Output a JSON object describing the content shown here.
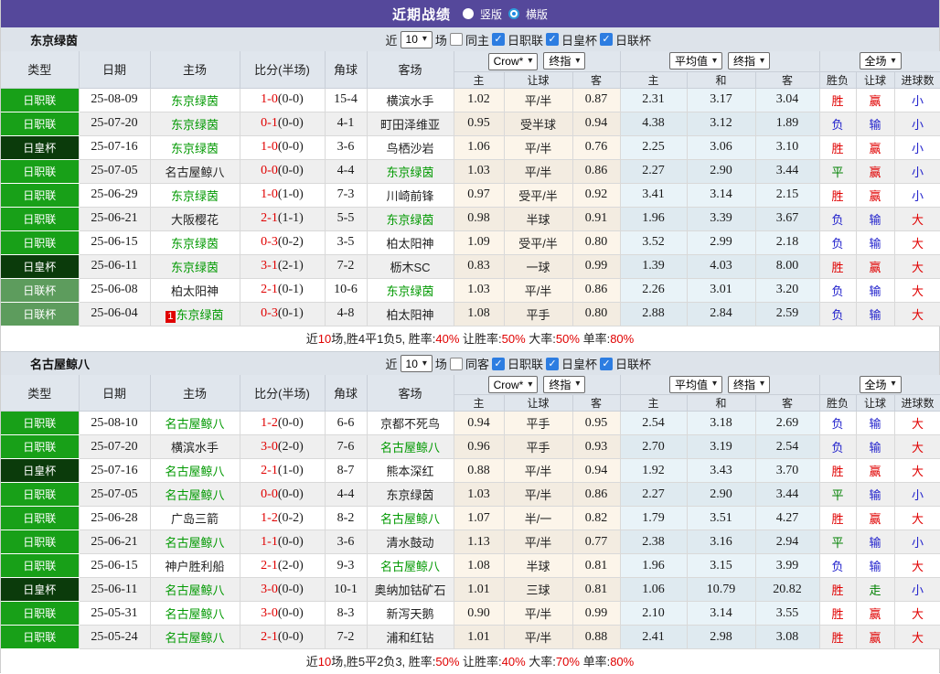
{
  "titlebar": {
    "title": "近期战绩",
    "radio_vertical": "竖版",
    "radio_horizontal": "横版"
  },
  "ui": {
    "near_label": "近",
    "games_value": "10",
    "games_label": "场",
    "league_filters": [
      "日职联",
      "日皇杯",
      "日联杯"
    ]
  },
  "table": {
    "main_headers": [
      "类型",
      "日期",
      "主场",
      "比分(半场)",
      "角球",
      "客场"
    ],
    "odds_subheaders": [
      "主",
      "让球",
      "客"
    ],
    "avg_subheaders": [
      "主",
      "和",
      "客"
    ],
    "result_subheaders": [
      "胜负",
      "让球",
      "进球数"
    ],
    "selects": {
      "bookmaker": "Crow*",
      "final_odds": "终指",
      "average": "平均值",
      "fulltime": "全场"
    }
  },
  "colors": {
    "header_bar": "#55489B",
    "league": {
      "日职联": "#18A018",
      "日皇杯": "#0B3B0B",
      "日联杯": "#5D9C5D"
    },
    "result_map": {
      "胜": "r-red",
      "平": "r-green",
      "负": "r-blue",
      "赢": "r-red",
      "走": "r-green",
      "输": "r-blue",
      "大": "r-red",
      "小": "r-blue"
    }
  },
  "sections": [
    {
      "team": "东京绿茵",
      "same_venue_label": "同主",
      "rows": [
        {
          "league": "日职联",
          "date": "25-08-09",
          "home": "东京绿茵",
          "home_focus": true,
          "home_badge": "",
          "score": "1-0",
          "half": "(0-0)",
          "corner": "15-4",
          "away": "横滨水手",
          "away_focus": false,
          "odds": [
            "1.02",
            "平/半",
            "0.87"
          ],
          "avg": [
            "2.31",
            "3.17",
            "3.04"
          ],
          "res": [
            "胜",
            "赢",
            "小"
          ]
        },
        {
          "league": "日职联",
          "date": "25-07-20",
          "home": "东京绿茵",
          "home_focus": true,
          "home_badge": "",
          "score": "0-1",
          "half": "(0-0)",
          "corner": "4-1",
          "away": "町田泽维亚",
          "away_focus": false,
          "odds": [
            "0.95",
            "受半球",
            "0.94"
          ],
          "avg": [
            "4.38",
            "3.12",
            "1.89"
          ],
          "res": [
            "负",
            "输",
            "小"
          ]
        },
        {
          "league": "日皇杯",
          "date": "25-07-16",
          "home": "东京绿茵",
          "home_focus": true,
          "home_badge": "",
          "score": "1-0",
          "half": "(0-0)",
          "corner": "3-6",
          "away": "鸟栖沙岩",
          "away_focus": false,
          "odds": [
            "1.06",
            "平/半",
            "0.76"
          ],
          "avg": [
            "2.25",
            "3.06",
            "3.10"
          ],
          "res": [
            "胜",
            "赢",
            "小"
          ]
        },
        {
          "league": "日职联",
          "date": "25-07-05",
          "home": "名古屋鲸八",
          "home_focus": false,
          "home_badge": "",
          "score": "0-0",
          "half": "(0-0)",
          "corner": "4-4",
          "away": "东京绿茵",
          "away_focus": true,
          "odds": [
            "1.03",
            "平/半",
            "0.86"
          ],
          "avg": [
            "2.27",
            "2.90",
            "3.44"
          ],
          "res": [
            "平",
            "赢",
            "小"
          ]
        },
        {
          "league": "日职联",
          "date": "25-06-29",
          "home": "东京绿茵",
          "home_focus": true,
          "home_badge": "",
          "score": "1-0",
          "half": "(1-0)",
          "corner": "7-3",
          "away": "川崎前锋",
          "away_focus": false,
          "odds": [
            "0.97",
            "受平/半",
            "0.92"
          ],
          "avg": [
            "3.41",
            "3.14",
            "2.15"
          ],
          "res": [
            "胜",
            "赢",
            "小"
          ]
        },
        {
          "league": "日职联",
          "date": "25-06-21",
          "home": "大阪樱花",
          "home_focus": false,
          "home_badge": "",
          "score": "2-1",
          "half": "(1-1)",
          "corner": "5-5",
          "away": "东京绿茵",
          "away_focus": true,
          "odds": [
            "0.98",
            "半球",
            "0.91"
          ],
          "avg": [
            "1.96",
            "3.39",
            "3.67"
          ],
          "res": [
            "负",
            "输",
            "大"
          ]
        },
        {
          "league": "日职联",
          "date": "25-06-15",
          "home": "东京绿茵",
          "home_focus": true,
          "home_badge": "",
          "score": "0-3",
          "half": "(0-2)",
          "corner": "3-5",
          "away": "柏太阳神",
          "away_focus": false,
          "odds": [
            "1.09",
            "受平/半",
            "0.80"
          ],
          "avg": [
            "3.52",
            "2.99",
            "2.18"
          ],
          "res": [
            "负",
            "输",
            "大"
          ]
        },
        {
          "league": "日皇杯",
          "date": "25-06-11",
          "home": "东京绿茵",
          "home_focus": true,
          "home_badge": "",
          "score": "3-1",
          "half": "(2-1)",
          "corner": "7-2",
          "away": "枥木SC",
          "away_focus": false,
          "odds": [
            "0.83",
            "一球",
            "0.99"
          ],
          "avg": [
            "1.39",
            "4.03",
            "8.00"
          ],
          "res": [
            "胜",
            "赢",
            "大"
          ]
        },
        {
          "league": "日联杯",
          "date": "25-06-08",
          "home": "柏太阳神",
          "home_focus": false,
          "home_badge": "",
          "score": "2-1",
          "half": "(0-1)",
          "corner": "10-6",
          "away": "东京绿茵",
          "away_focus": true,
          "odds": [
            "1.03",
            "平/半",
            "0.86"
          ],
          "avg": [
            "2.26",
            "3.01",
            "3.20"
          ],
          "res": [
            "负",
            "输",
            "大"
          ]
        },
        {
          "league": "日联杯",
          "date": "25-06-04",
          "home": "东京绿茵",
          "home_focus": true,
          "home_badge": "1",
          "score": "0-3",
          "half": "(0-1)",
          "corner": "4-8",
          "away": "柏太阳神",
          "away_focus": false,
          "odds": [
            "1.08",
            "平手",
            "0.80"
          ],
          "avg": [
            "2.88",
            "2.84",
            "2.59"
          ],
          "res": [
            "负",
            "输",
            "大"
          ]
        }
      ],
      "summary": [
        {
          "text": "近"
        },
        {
          "text": "10",
          "red": true
        },
        {
          "text": "场,胜4平1负5, 胜率:"
        },
        {
          "text": "40%",
          "red": true
        },
        {
          "text": " 让胜率:"
        },
        {
          "text": "50%",
          "red": true
        },
        {
          "text": " 大率:"
        },
        {
          "text": "50%",
          "red": true
        },
        {
          "text": " 单率:"
        },
        {
          "text": "80%",
          "red": true
        }
      ]
    },
    {
      "team": "名古屋鲸八",
      "same_venue_label": "同客",
      "rows": [
        {
          "league": "日职联",
          "date": "25-08-10",
          "home": "名古屋鲸八",
          "home_focus": true,
          "home_badge": "",
          "score": "1-2",
          "half": "(0-0)",
          "corner": "6-6",
          "away": "京都不死鸟",
          "away_focus": false,
          "odds": [
            "0.94",
            "平手",
            "0.95"
          ],
          "avg": [
            "2.54",
            "3.18",
            "2.69"
          ],
          "res": [
            "负",
            "输",
            "大"
          ]
        },
        {
          "league": "日职联",
          "date": "25-07-20",
          "home": "横滨水手",
          "home_focus": false,
          "home_badge": "",
          "score": "3-0",
          "half": "(2-0)",
          "corner": "7-6",
          "away": "名古屋鲸八",
          "away_focus": true,
          "odds": [
            "0.96",
            "平手",
            "0.93"
          ],
          "avg": [
            "2.70",
            "3.19",
            "2.54"
          ],
          "res": [
            "负",
            "输",
            "大"
          ]
        },
        {
          "league": "日皇杯",
          "date": "25-07-16",
          "home": "名古屋鲸八",
          "home_focus": true,
          "home_badge": "",
          "score": "2-1",
          "half": "(1-0)",
          "corner": "8-7",
          "away": "熊本深红",
          "away_focus": false,
          "odds": [
            "0.88",
            "平/半",
            "0.94"
          ],
          "avg": [
            "1.92",
            "3.43",
            "3.70"
          ],
          "res": [
            "胜",
            "赢",
            "大"
          ]
        },
        {
          "league": "日职联",
          "date": "25-07-05",
          "home": "名古屋鲸八",
          "home_focus": true,
          "home_badge": "",
          "score": "0-0",
          "half": "(0-0)",
          "corner": "4-4",
          "away": "东京绿茵",
          "away_focus": false,
          "odds": [
            "1.03",
            "平/半",
            "0.86"
          ],
          "avg": [
            "2.27",
            "2.90",
            "3.44"
          ],
          "res": [
            "平",
            "输",
            "小"
          ]
        },
        {
          "league": "日职联",
          "date": "25-06-28",
          "home": "广岛三箭",
          "home_focus": false,
          "home_badge": "",
          "score": "1-2",
          "half": "(0-2)",
          "corner": "8-2",
          "away": "名古屋鲸八",
          "away_focus": true,
          "odds": [
            "1.07",
            "半/一",
            "0.82"
          ],
          "avg": [
            "1.79",
            "3.51",
            "4.27"
          ],
          "res": [
            "胜",
            "赢",
            "大"
          ]
        },
        {
          "league": "日职联",
          "date": "25-06-21",
          "home": "名古屋鲸八",
          "home_focus": true,
          "home_badge": "",
          "score": "1-1",
          "half": "(0-0)",
          "corner": "3-6",
          "away": "清水鼓动",
          "away_focus": false,
          "odds": [
            "1.13",
            "平/半",
            "0.77"
          ],
          "avg": [
            "2.38",
            "3.16",
            "2.94"
          ],
          "res": [
            "平",
            "输",
            "小"
          ]
        },
        {
          "league": "日职联",
          "date": "25-06-15",
          "home": "神户胜利船",
          "home_focus": false,
          "home_badge": "",
          "score": "2-1",
          "half": "(2-0)",
          "corner": "9-3",
          "away": "名古屋鲸八",
          "away_focus": true,
          "odds": [
            "1.08",
            "半球",
            "0.81"
          ],
          "avg": [
            "1.96",
            "3.15",
            "3.99"
          ],
          "res": [
            "负",
            "输",
            "大"
          ]
        },
        {
          "league": "日皇杯",
          "date": "25-06-11",
          "home": "名古屋鲸八",
          "home_focus": true,
          "home_badge": "",
          "score": "3-0",
          "half": "(0-0)",
          "corner": "10-1",
          "away": "奥纳加钴矿石",
          "away_focus": false,
          "odds": [
            "1.01",
            "三球",
            "0.81"
          ],
          "avg": [
            "1.06",
            "10.79",
            "20.82"
          ],
          "res": [
            "胜",
            "走",
            "小"
          ]
        },
        {
          "league": "日职联",
          "date": "25-05-31",
          "home": "名古屋鲸八",
          "home_focus": true,
          "home_badge": "",
          "score": "3-0",
          "half": "(0-0)",
          "corner": "8-3",
          "away": "新泻天鹅",
          "away_focus": false,
          "odds": [
            "0.90",
            "平/半",
            "0.99"
          ],
          "avg": [
            "2.10",
            "3.14",
            "3.55"
          ],
          "res": [
            "胜",
            "赢",
            "大"
          ]
        },
        {
          "league": "日职联",
          "date": "25-05-24",
          "home": "名古屋鲸八",
          "home_focus": true,
          "home_badge": "",
          "score": "2-1",
          "half": "(0-0)",
          "corner": "7-2",
          "away": "浦和红钻",
          "away_focus": false,
          "odds": [
            "1.01",
            "平/半",
            "0.88"
          ],
          "avg": [
            "2.41",
            "2.98",
            "3.08"
          ],
          "res": [
            "胜",
            "赢",
            "大"
          ]
        }
      ],
      "summary": [
        {
          "text": "近"
        },
        {
          "text": "10",
          "red": true
        },
        {
          "text": "场,胜5平2负3, 胜率:"
        },
        {
          "text": "50%",
          "red": true
        },
        {
          "text": " 让胜率:"
        },
        {
          "text": "40%",
          "red": true
        },
        {
          "text": " 大率:"
        },
        {
          "text": "70%",
          "red": true
        },
        {
          "text": " 单率:"
        },
        {
          "text": "80%",
          "red": true
        }
      ]
    }
  ]
}
